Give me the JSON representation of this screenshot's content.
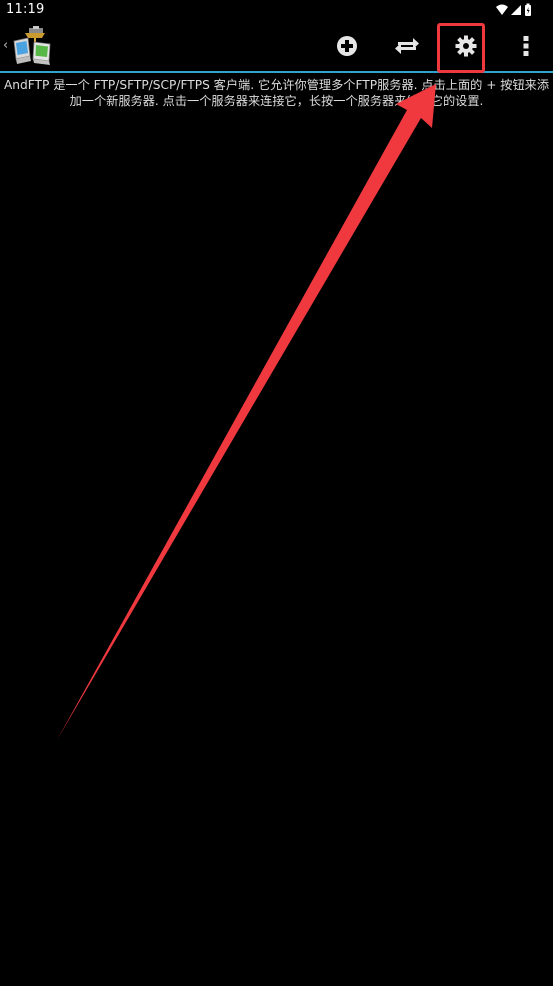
{
  "status_bar": {
    "time": "11:19",
    "icons": [
      "wifi-icon",
      "cell-signal-icon",
      "battery-icon"
    ]
  },
  "action_bar": {
    "app_icon": "andftp-logo-icon",
    "actions": [
      {
        "name": "add-server-button",
        "icon": "plus-circle-icon"
      },
      {
        "name": "transfer-button",
        "icon": "swap-arrows-icon"
      },
      {
        "name": "settings-button",
        "icon": "gear-icon"
      },
      {
        "name": "overflow-menu-button",
        "icon": "more-vert-icon"
      }
    ]
  },
  "main": {
    "intro_text": "AndFTP 是一个 FTP/SFTP/SCP/FTPS 客户端. 它允许你管理多个FTP服务器. 点击上面的 + 按钮来添加一个新服务器. 点击一个服务器来连接它，长按一个服务器来编辑它的设置."
  },
  "colors": {
    "background": "#000000",
    "accent_divider": "#2ea4cf",
    "annotation_red": "#f0393f",
    "icon": "#e6e6e6"
  }
}
